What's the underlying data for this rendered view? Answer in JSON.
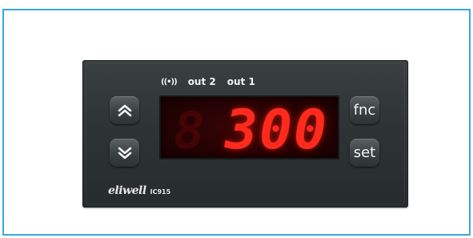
{
  "device": {
    "status": {
      "signal_icon": "wireless-signal-icon",
      "out2_label": "out 2",
      "out1_label": "out 1"
    },
    "display": {
      "value": "300",
      "color": "#ff2a1e"
    },
    "buttons": {
      "up_icon": "chevron-up-icon",
      "down_icon": "chevron-down-icon",
      "fnc_label": "fnc",
      "set_label": "set"
    },
    "brand": {
      "logo": "eliwell",
      "model": "IC915"
    }
  },
  "colors": {
    "frame_border": "#38a8e0",
    "panel": "#2e3333",
    "display_bg": "#200203"
  }
}
